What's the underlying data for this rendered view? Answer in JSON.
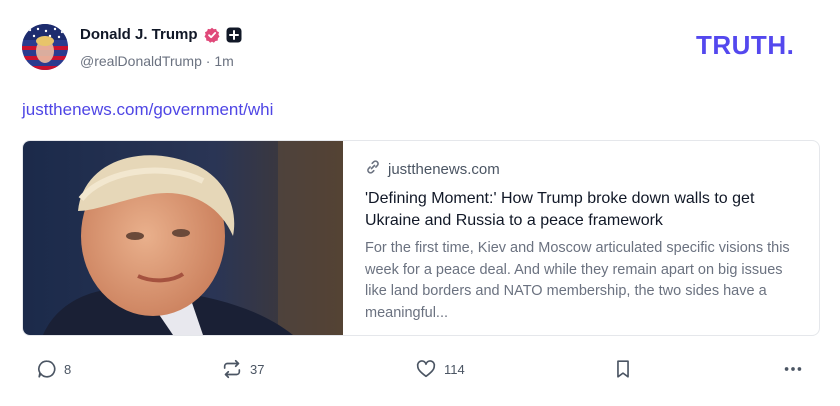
{
  "post": {
    "author_name": "Donald J. Trump",
    "handle": "@realDonaldTrump",
    "time": "1m",
    "separator": "·",
    "link_text": "justthenews.com/government/whi"
  },
  "brand": {
    "logo_text": "TRUTH.",
    "accent_color": "#5448ee"
  },
  "card": {
    "domain": "justthenews.com",
    "title": "'Defining Moment:' How Trump broke down walls to get Ukraine and Russia to a peace framework",
    "description": "For the first time, Kiev and Moscow articulated specific visions this week for a peace deal. And while they remain apart on big issues like land borders and NATO membership, the two sides have a meaningful..."
  },
  "actions": {
    "replies": "8",
    "retruths": "37",
    "likes": "114"
  },
  "icons": {
    "verified": "verified-badge-icon",
    "plus": "plus-badge-icon",
    "link": "link-icon",
    "reply": "comment-icon",
    "retruth": "retruth-icon",
    "like": "heart-icon",
    "bookmark": "bookmark-icon",
    "more": "more-dots-icon"
  }
}
